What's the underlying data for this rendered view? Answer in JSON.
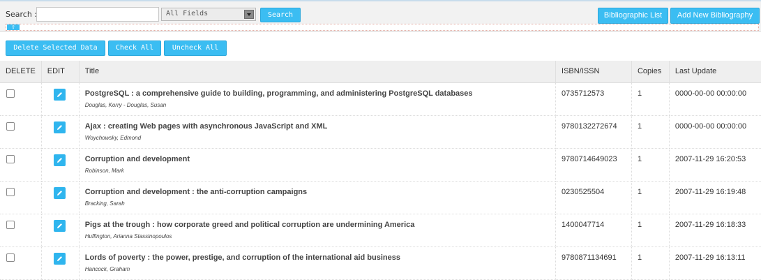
{
  "search": {
    "label": "Search :",
    "value": "",
    "placeholder": "",
    "field_select": "All Fields",
    "button_label": "Search"
  },
  "top_buttons": {
    "bibliographic_list": "Bibliographic List",
    "add_new": "Add New Bibliography"
  },
  "advanced_toggle": "⇧",
  "actions": {
    "delete_selected": "Delete Selected Data",
    "check_all": "Check All",
    "uncheck_all": "Uncheck All"
  },
  "table": {
    "headers": {
      "delete": "DELETE",
      "edit": "EDIT",
      "title": "Title",
      "isbn": "ISBN/ISSN",
      "copies": "Copies",
      "last_update": "Last Update"
    },
    "rows": [
      {
        "title": "PostgreSQL : a comprehensive guide to building, programming, and administering PostgreSQL databases",
        "author": "Douglas, Korry - Douglas, Susan",
        "isbn": "0735712573",
        "copies": "1",
        "last_update": "0000-00-00 00:00:00"
      },
      {
        "title": "Ajax : creating Web pages with asynchronous JavaScript and XML",
        "author": "Woychowsky, Edmond",
        "isbn": "9780132272674",
        "copies": "1",
        "last_update": "0000-00-00 00:00:00"
      },
      {
        "title": "Corruption and development",
        "author": "Robinson, Mark",
        "isbn": "9780714649023",
        "copies": "1",
        "last_update": "2007-11-29 16:20:53"
      },
      {
        "title": "Corruption and development : the anti-corruption campaigns",
        "author": "Bracking, Sarah",
        "isbn": "0230525504",
        "copies": "1",
        "last_update": "2007-11-29 16:19:48"
      },
      {
        "title": "Pigs at the trough : how corporate greed and political corruption are undermining America",
        "author": "Huffington, Arianna Stassinopoulos",
        "isbn": "1400047714",
        "copies": "1",
        "last_update": "2007-11-29 16:18:33"
      },
      {
        "title": "Lords of poverty : the power, prestige, and corruption of the international aid business",
        "author": "Hancock, Graham",
        "isbn": "9780871134691",
        "copies": "1",
        "last_update": "2007-11-29 16:13:11"
      }
    ]
  },
  "colors": {
    "accent": "#3bbdf2",
    "header_bg": "#efefef"
  }
}
